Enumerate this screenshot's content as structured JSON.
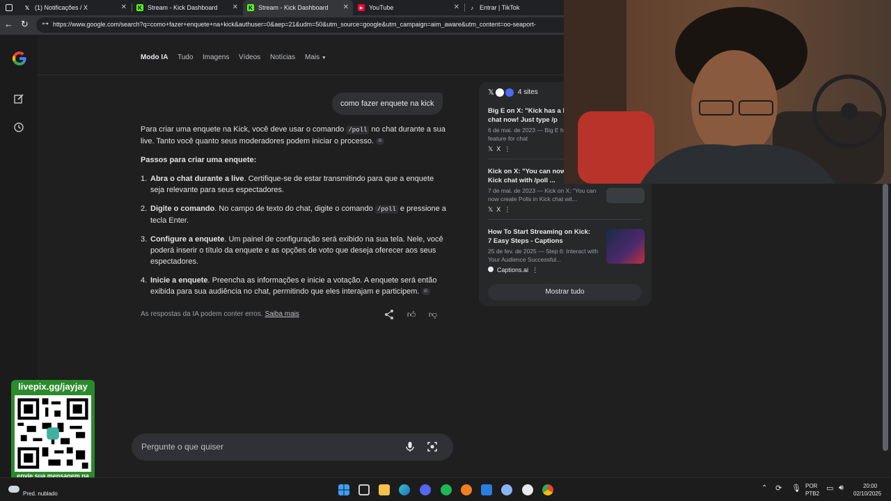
{
  "tabs": [
    {
      "title": "(1) Notificações / X",
      "icon": "x-logo-icon"
    },
    {
      "title": "Stream - Kick Dashboard",
      "icon": "kick-logo-icon"
    },
    {
      "title": "Stream - Kick Dashboard",
      "icon": "kick-logo-icon"
    },
    {
      "title": "YouTube",
      "icon": "youtube-logo-icon"
    },
    {
      "title": "Entrar | TikTok",
      "icon": "tiktok-logo-icon"
    }
  ],
  "url": "https://www.google.com/search?q=como+fazer+enquete+na+kick&authuser=0&aep=21&udm=50&utm_source=google&utm_campaign=aim_aware&utm_content=oo-seaport-",
  "nav": {
    "items": [
      "Modo IA",
      "Tudo",
      "Imagens",
      "Vídeos",
      "Notícias",
      "Mais"
    ],
    "active": "Modo IA"
  },
  "query": "como fazer enquete na kick",
  "answer": {
    "intro_a": "Para criar uma enquete na Kick, você deve usar o comando ",
    "intro_code": "/poll",
    "intro_b": " no chat durante a sua live. Tanto você quanto seus moderadores podem iniciar o processo.",
    "steps_heading": "Passos para criar uma enquete:",
    "steps": [
      {
        "num": "1.",
        "bold": "Abra o chat durante a live",
        "text": ". Certifique-se de estar transmitindo para que a enquete seja relevante para seus espectadores.",
        "code": "",
        "text2": ""
      },
      {
        "num": "2.",
        "bold": "Digite o comando",
        "text": ". No campo de texto do chat, digite o comando ",
        "code": "/poll",
        "text2": " e pressione a tecla Enter."
      },
      {
        "num": "3.",
        "bold": "Configure a enquete",
        "text": ". Um painel de configuração será exibido na sua tela. Nele, você poderá inserir o título da enquete e as opções de voto que deseja oferecer aos seus espectadores.",
        "code": "",
        "text2": ""
      },
      {
        "num": "4.",
        "bold": "Inicie a enquete",
        "text": ". Preencha as informações e inicie a votação. A enquete será então exibida para sua audiência no chat, permitindo que eles interajam e participem.",
        "code": "",
        "text2": ""
      }
    ]
  },
  "disclaimer": {
    "text": "As respostas da IA podem conter erros. ",
    "link": "Saiba mais"
  },
  "sources": {
    "count_label": "4 sites",
    "items": [
      {
        "title": "Big E on X: \"Kick has a Po for chat now! Just type /p",
        "snippet": "6 de mai. de 2023 — Big E has a Poll feature for chat",
        "site": "X"
      },
      {
        "title": "Kick on X: \"You can now c in Kick chat with /poll ...",
        "snippet": "7 de mai. de 2023 — Kick on X: \"You can now create Polls in Kick chat wit...",
        "site": "X"
      },
      {
        "title": "How To Start Streaming on Kick: 7 Easy Steps - Captions",
        "snippet": "25 de fev. de 2025 — Step 6: Interact with Your Audience Successful...",
        "site": "Captions.ai"
      }
    ],
    "show_all": "Mostrar tudo"
  },
  "ask_placeholder": "Pergunte o que quiser",
  "qr": {
    "header": "livepix.gg/jayjay",
    "footer": "envie sua mensagem na live via pix!"
  },
  "taskbar": {
    "weather": "Pred. nublado",
    "lang_top": "POR",
    "lang_bottom": "PTB2",
    "time": "20:00",
    "date": "02/10/2025"
  },
  "colors": {
    "kick_green": "#53fc18",
    "youtube_red": "#ff0033",
    "qr_green": "#2b8a2b"
  }
}
